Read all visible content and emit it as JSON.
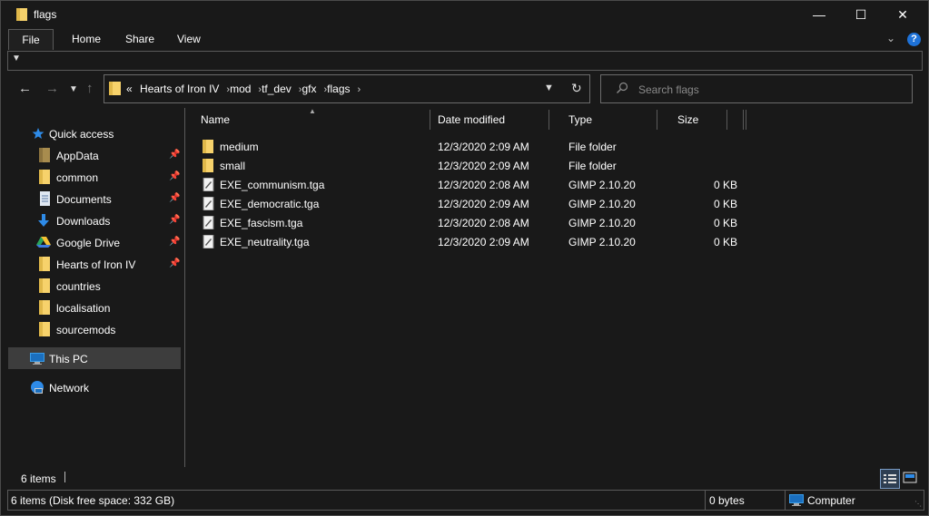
{
  "window": {
    "title": "flags",
    "minimize_glyph": "—",
    "maximize_glyph": "☐",
    "close_glyph": "✕"
  },
  "ribbon": {
    "tabs": [
      {
        "label": "File"
      },
      {
        "label": "Home"
      },
      {
        "label": "Share"
      },
      {
        "label": "View"
      }
    ],
    "help_glyph": "?"
  },
  "navigation": {
    "breadcrumb_prefix": "«",
    "breadcrumb": [
      "Hearts of Iron IV",
      "mod",
      "tf_dev",
      "gfx",
      "flags"
    ],
    "search_placeholder": "Search flags"
  },
  "sidebar": {
    "items": [
      {
        "label": "Quick access",
        "icon": "star-icon",
        "pinned": false
      },
      {
        "label": "AppData",
        "icon": "folder-icon",
        "pinned": true
      },
      {
        "label": "common",
        "icon": "folder-icon",
        "pinned": true
      },
      {
        "label": "Documents",
        "icon": "document-icon",
        "pinned": true
      },
      {
        "label": "Downloads",
        "icon": "download-icon",
        "pinned": true
      },
      {
        "label": "Google Drive",
        "icon": "google-drive-icon",
        "pinned": true
      },
      {
        "label": "Hearts of Iron IV",
        "icon": "folder-icon",
        "pinned": true
      },
      {
        "label": "countries",
        "icon": "folder-icon",
        "pinned": false
      },
      {
        "label": "localisation",
        "icon": "folder-icon",
        "pinned": false
      },
      {
        "label": "sourcemods",
        "icon": "folder-icon",
        "pinned": false
      },
      {
        "label": "This PC",
        "icon": "computer-icon",
        "selected": true
      },
      {
        "label": "Network",
        "icon": "network-icon",
        "pinned": false
      }
    ]
  },
  "columns": [
    {
      "label": "Name"
    },
    {
      "label": "Date modified"
    },
    {
      "label": "Type"
    },
    {
      "label": "Size"
    }
  ],
  "files": [
    {
      "name": "medium",
      "date": "12/3/2020 2:09 AM",
      "type": "File folder",
      "size": "",
      "icon": "folder-icon"
    },
    {
      "name": "small",
      "date": "12/3/2020 2:09 AM",
      "type": "File folder",
      "size": "",
      "icon": "folder-icon"
    },
    {
      "name": "EXE_communism.tga",
      "date": "12/3/2020 2:08 AM",
      "type": "GIMP 2.10.20",
      "size": "0 KB",
      "icon": "gimp-file-icon"
    },
    {
      "name": "EXE_democratic.tga",
      "date": "12/3/2020 2:09 AM",
      "type": "GIMP 2.10.20",
      "size": "0 KB",
      "icon": "gimp-file-icon"
    },
    {
      "name": "EXE_fascism.tga",
      "date": "12/3/2020 2:08 AM",
      "type": "GIMP 2.10.20",
      "size": "0 KB",
      "icon": "gimp-file-icon"
    },
    {
      "name": "EXE_neutrality.tga",
      "date": "12/3/2020 2:09 AM",
      "type": "GIMP 2.10.20",
      "size": "0 KB",
      "icon": "gimp-file-icon"
    }
  ],
  "status": {
    "item_count": "6 items",
    "bar_left": "6 items (Disk free space: 332 GB)",
    "bar_size": "0 bytes",
    "bar_location": "Computer"
  },
  "colors": {
    "background": "#191919",
    "folder": "#f7d26b",
    "accent_blue": "#1e72d8",
    "selected": "#3d3d3d"
  }
}
